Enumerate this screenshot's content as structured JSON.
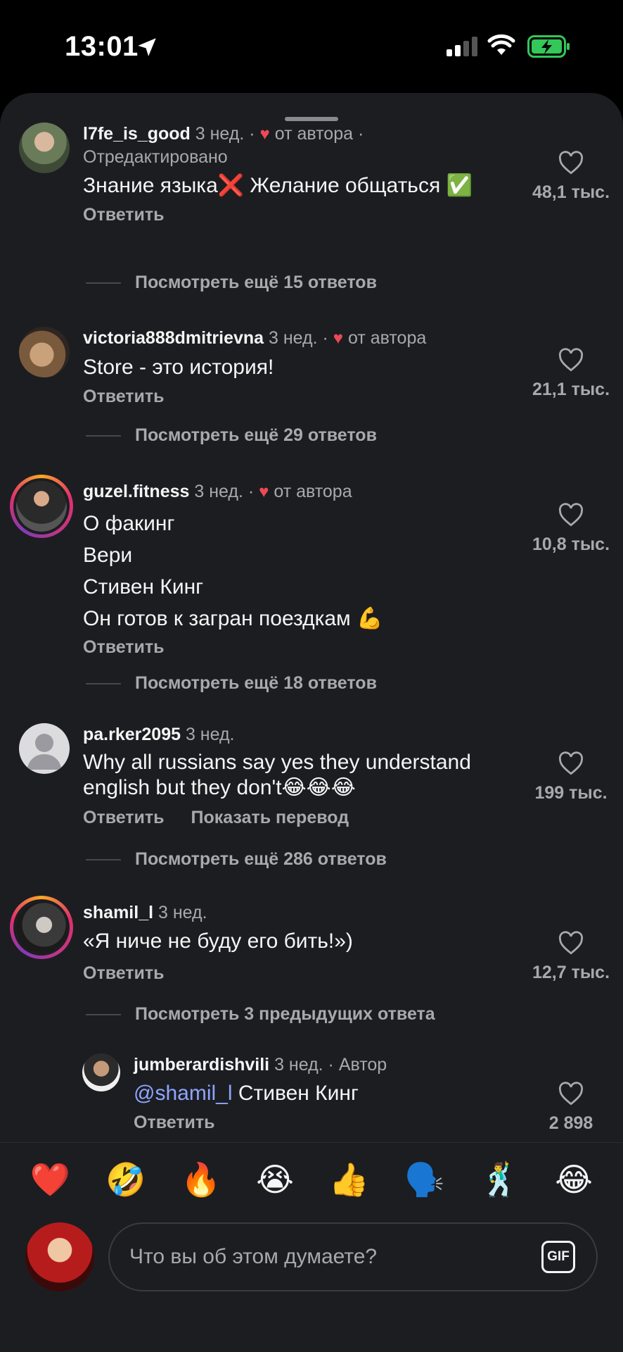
{
  "status_bar": {
    "time": "13:01"
  },
  "comments": [
    {
      "username": "l7fe_is_good",
      "meta": " 3 нед. · ",
      "author_heart": "♥",
      "author_label": " от автора ·",
      "edited": "Отредактировано",
      "text": [
        "Знание языка❌ Желание общаться ✅"
      ],
      "reply_label": "Ответить",
      "likes": "48,1 тыс.",
      "more_replies": "Посмотреть ещё 15 ответов"
    },
    {
      "username": "victoria888dmitrievna",
      "meta": " 3 нед. · ",
      "author_heart": "♥",
      "author_label": " от автора",
      "text": [
        "Store - это история!"
      ],
      "reply_label": "Ответить",
      "likes": "21,1 тыс.",
      "more_replies": "Посмотреть ещё 29 ответов"
    },
    {
      "username": "guzel.fitness",
      "meta": " 3 нед. · ",
      "author_heart": "♥",
      "author_label": " от автора",
      "text": [
        "О факинг",
        "Вери",
        "Стивен Кинг",
        "Он готов к загран поездкам 💪"
      ],
      "reply_label": "Ответить",
      "likes": "10,8 тыс.",
      "more_replies": "Посмотреть ещё 18 ответов"
    },
    {
      "username": "pa.rker2095",
      "meta": " 3 нед.",
      "text": [
        "Why all russians say yes they understand",
        "english but they don't😂😂😂"
      ],
      "reply_label": "Ответить",
      "translate_label": "Показать перевод",
      "likes": "199 тыс.",
      "more_replies": "Посмотреть ещё 286 ответов"
    },
    {
      "username": "shamil_l",
      "meta": " 3 нед.",
      "text": [
        "«Я ниче не буду его бить!»)"
      ],
      "reply_label": "Ответить",
      "likes": "12,7 тыс.",
      "more_replies": "Посмотреть 3 предыдущих ответа"
    }
  ],
  "reply": {
    "username": "jumberardishvili",
    "meta": " 3 нед. · Автор",
    "mention": "@shamil_l",
    "text": " Стивен Кинг",
    "reply_label": "Ответить",
    "likes": "2 898"
  },
  "emoji_bar": [
    "❤️",
    "🤣",
    "🔥",
    "😭",
    "👍",
    "🗣️",
    "🕺",
    "😂"
  ],
  "composer": {
    "placeholder": "Что вы об этом думаете?",
    "gif_label": "GIF"
  },
  "colors": {
    "sheet": "#1c1d21",
    "heart": "#ed4956",
    "mention": "#8fa5ff"
  }
}
